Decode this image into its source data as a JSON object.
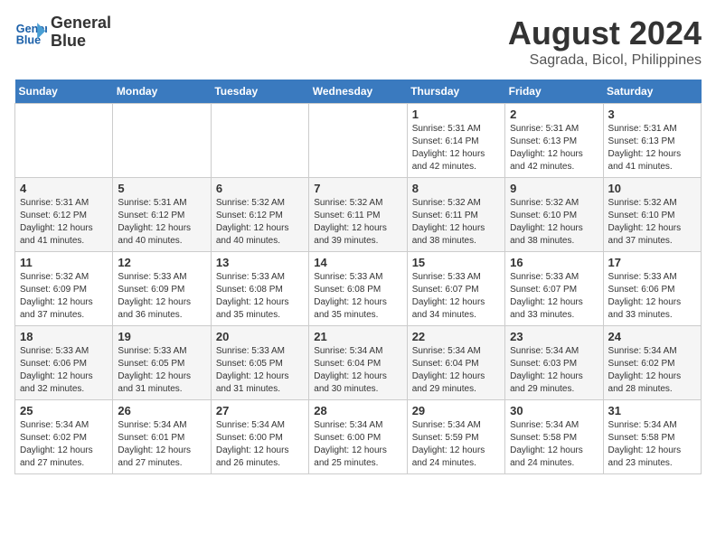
{
  "logo": {
    "line1": "General",
    "line2": "Blue"
  },
  "title": "August 2024",
  "subtitle": "Sagrada, Bicol, Philippines",
  "days_of_week": [
    "Sunday",
    "Monday",
    "Tuesday",
    "Wednesday",
    "Thursday",
    "Friday",
    "Saturday"
  ],
  "weeks": [
    [
      {
        "day": "",
        "info": ""
      },
      {
        "day": "",
        "info": ""
      },
      {
        "day": "",
        "info": ""
      },
      {
        "day": "",
        "info": ""
      },
      {
        "day": "1",
        "info": "Sunrise: 5:31 AM\nSunset: 6:14 PM\nDaylight: 12 hours\nand 42 minutes."
      },
      {
        "day": "2",
        "info": "Sunrise: 5:31 AM\nSunset: 6:13 PM\nDaylight: 12 hours\nand 42 minutes."
      },
      {
        "day": "3",
        "info": "Sunrise: 5:31 AM\nSunset: 6:13 PM\nDaylight: 12 hours\nand 41 minutes."
      }
    ],
    [
      {
        "day": "4",
        "info": "Sunrise: 5:31 AM\nSunset: 6:12 PM\nDaylight: 12 hours\nand 41 minutes."
      },
      {
        "day": "5",
        "info": "Sunrise: 5:31 AM\nSunset: 6:12 PM\nDaylight: 12 hours\nand 40 minutes."
      },
      {
        "day": "6",
        "info": "Sunrise: 5:32 AM\nSunset: 6:12 PM\nDaylight: 12 hours\nand 40 minutes."
      },
      {
        "day": "7",
        "info": "Sunrise: 5:32 AM\nSunset: 6:11 PM\nDaylight: 12 hours\nand 39 minutes."
      },
      {
        "day": "8",
        "info": "Sunrise: 5:32 AM\nSunset: 6:11 PM\nDaylight: 12 hours\nand 38 minutes."
      },
      {
        "day": "9",
        "info": "Sunrise: 5:32 AM\nSunset: 6:10 PM\nDaylight: 12 hours\nand 38 minutes."
      },
      {
        "day": "10",
        "info": "Sunrise: 5:32 AM\nSunset: 6:10 PM\nDaylight: 12 hours\nand 37 minutes."
      }
    ],
    [
      {
        "day": "11",
        "info": "Sunrise: 5:32 AM\nSunset: 6:09 PM\nDaylight: 12 hours\nand 37 minutes."
      },
      {
        "day": "12",
        "info": "Sunrise: 5:33 AM\nSunset: 6:09 PM\nDaylight: 12 hours\nand 36 minutes."
      },
      {
        "day": "13",
        "info": "Sunrise: 5:33 AM\nSunset: 6:08 PM\nDaylight: 12 hours\nand 35 minutes."
      },
      {
        "day": "14",
        "info": "Sunrise: 5:33 AM\nSunset: 6:08 PM\nDaylight: 12 hours\nand 35 minutes."
      },
      {
        "day": "15",
        "info": "Sunrise: 5:33 AM\nSunset: 6:07 PM\nDaylight: 12 hours\nand 34 minutes."
      },
      {
        "day": "16",
        "info": "Sunrise: 5:33 AM\nSunset: 6:07 PM\nDaylight: 12 hours\nand 33 minutes."
      },
      {
        "day": "17",
        "info": "Sunrise: 5:33 AM\nSunset: 6:06 PM\nDaylight: 12 hours\nand 33 minutes."
      }
    ],
    [
      {
        "day": "18",
        "info": "Sunrise: 5:33 AM\nSunset: 6:06 PM\nDaylight: 12 hours\nand 32 minutes."
      },
      {
        "day": "19",
        "info": "Sunrise: 5:33 AM\nSunset: 6:05 PM\nDaylight: 12 hours\nand 31 minutes."
      },
      {
        "day": "20",
        "info": "Sunrise: 5:33 AM\nSunset: 6:05 PM\nDaylight: 12 hours\nand 31 minutes."
      },
      {
        "day": "21",
        "info": "Sunrise: 5:34 AM\nSunset: 6:04 PM\nDaylight: 12 hours\nand 30 minutes."
      },
      {
        "day": "22",
        "info": "Sunrise: 5:34 AM\nSunset: 6:04 PM\nDaylight: 12 hours\nand 29 minutes."
      },
      {
        "day": "23",
        "info": "Sunrise: 5:34 AM\nSunset: 6:03 PM\nDaylight: 12 hours\nand 29 minutes."
      },
      {
        "day": "24",
        "info": "Sunrise: 5:34 AM\nSunset: 6:02 PM\nDaylight: 12 hours\nand 28 minutes."
      }
    ],
    [
      {
        "day": "25",
        "info": "Sunrise: 5:34 AM\nSunset: 6:02 PM\nDaylight: 12 hours\nand 27 minutes."
      },
      {
        "day": "26",
        "info": "Sunrise: 5:34 AM\nSunset: 6:01 PM\nDaylight: 12 hours\nand 27 minutes."
      },
      {
        "day": "27",
        "info": "Sunrise: 5:34 AM\nSunset: 6:00 PM\nDaylight: 12 hours\nand 26 minutes."
      },
      {
        "day": "28",
        "info": "Sunrise: 5:34 AM\nSunset: 6:00 PM\nDaylight: 12 hours\nand 25 minutes."
      },
      {
        "day": "29",
        "info": "Sunrise: 5:34 AM\nSunset: 5:59 PM\nDaylight: 12 hours\nand 24 minutes."
      },
      {
        "day": "30",
        "info": "Sunrise: 5:34 AM\nSunset: 5:58 PM\nDaylight: 12 hours\nand 24 minutes."
      },
      {
        "day": "31",
        "info": "Sunrise: 5:34 AM\nSunset: 5:58 PM\nDaylight: 12 hours\nand 23 minutes."
      }
    ]
  ]
}
